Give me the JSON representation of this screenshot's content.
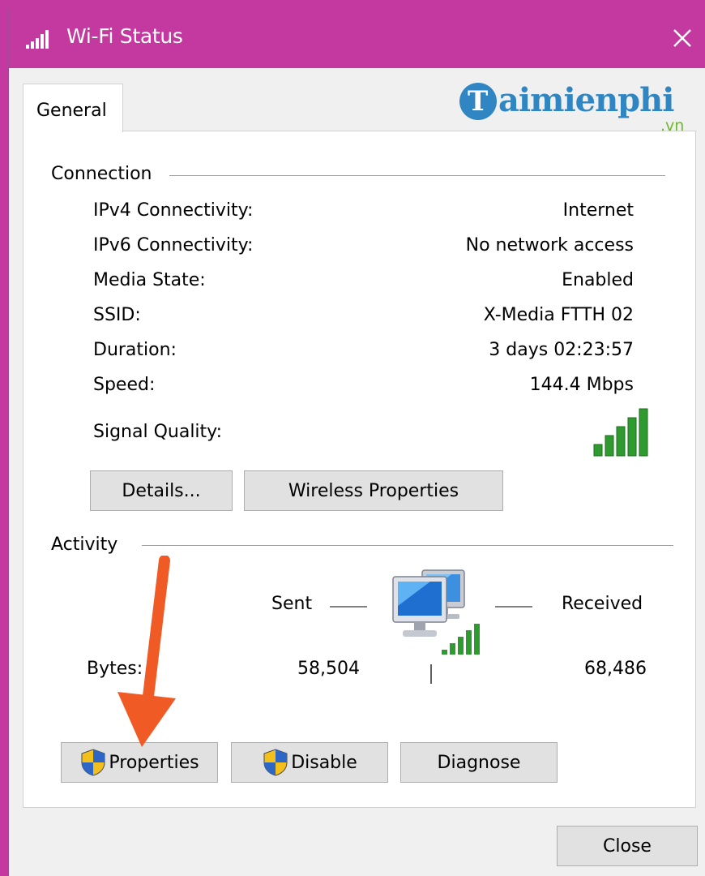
{
  "window": {
    "title": "Wi-Fi Status",
    "title_icon": "wifi-signal-icon",
    "close_icon": "close-icon",
    "accent_color": "#c3399f"
  },
  "tabs": [
    {
      "label": "General",
      "selected": true
    }
  ],
  "watermark": {
    "brand": "aimienphi",
    "initial": "T",
    "suffix": ".vn"
  },
  "connection": {
    "title": "Connection",
    "rows": [
      {
        "label": "IPv4 Connectivity:",
        "value": "Internet"
      },
      {
        "label": "IPv6 Connectivity:",
        "value": "No network access"
      },
      {
        "label": "Media State:",
        "value": "Enabled"
      },
      {
        "label": "SSID:",
        "value": "X-Media FTTH 02"
      },
      {
        "label": "Duration:",
        "value": "3 days 02:23:57"
      },
      {
        "label": "Speed:",
        "value": "144.4 Mbps"
      }
    ],
    "signal_label": "Signal Quality:",
    "signal_bars_lit": 5,
    "signal_bars_total": 5,
    "buttons": {
      "details": "Details...",
      "wireless_properties": "Wireless Properties"
    }
  },
  "activity": {
    "title": "Activity",
    "sent_label": "Sent",
    "received_label": "Received",
    "bytes_label": "Bytes:",
    "bytes_sent": "58,504",
    "bytes_received": "68,486",
    "icon": "network-computers-icon"
  },
  "actions": {
    "properties": "Properties",
    "disable": "Disable",
    "diagnose": "Diagnose",
    "shield_icon": "uac-shield-icon"
  },
  "footer": {
    "close": "Close"
  },
  "annotation": {
    "arrow_color": "#f05a24"
  }
}
